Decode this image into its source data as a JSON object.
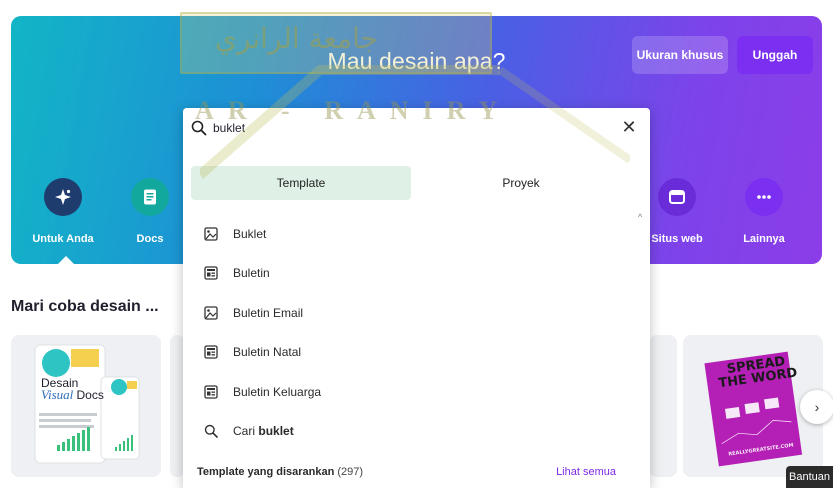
{
  "hero": {
    "title": "Mau desain apa?",
    "custom_size_label": "Ukuran khusus",
    "upload_label": "Unggah"
  },
  "categories": [
    {
      "label": "Untuk Anda",
      "icon": "sparkle-icon",
      "color": "#1e3c6e",
      "active": true
    },
    {
      "label": "Docs",
      "icon": "document-icon",
      "color": "#13a89e"
    },
    {
      "label": "Situs web",
      "icon": "browser-icon",
      "color": "#6a2cd8"
    },
    {
      "label": "Lainnya",
      "icon": "more-dots-icon",
      "color": "#7b2ff0"
    }
  ],
  "search": {
    "value": "buklet",
    "placeholder": ""
  },
  "tabs": [
    {
      "label": "Template",
      "active": true
    },
    {
      "label": "Proyek",
      "active": false
    }
  ],
  "suggestions": [
    {
      "label": "Buklet",
      "icon": "image-icon"
    },
    {
      "label": "Buletin",
      "icon": "newsletter-icon"
    },
    {
      "label": "Buletin Email",
      "icon": "image-icon"
    },
    {
      "label": "Buletin Natal",
      "icon": "newsletter-icon"
    },
    {
      "label": "Buletin Keluarga",
      "icon": "newsletter-icon"
    }
  ],
  "search_suggestion": {
    "prefix": "Cari",
    "term": "buklet"
  },
  "recommended": {
    "title": "Template yang disarankan",
    "count": "(297)",
    "see_all": "Lihat semua"
  },
  "section": {
    "title": "Mari coba desain ..."
  },
  "cards": {
    "docs_card": {
      "line1": "Desain",
      "line2": "Visual",
      "line3": "Docs"
    },
    "poster_card": {
      "line1": "SPREAD",
      "line2": "THE WORD",
      "footer": "REALLYGREATSITE.COM"
    }
  },
  "help_label": "Bantuan",
  "watermark": {
    "arabic": "جامعة الرانري",
    "latin": "A R - R A N I R Y"
  },
  "colors": {
    "accent": "#7d2ae8",
    "upload_button": "#7b2ff0",
    "tab_active": "#dff0e6"
  }
}
